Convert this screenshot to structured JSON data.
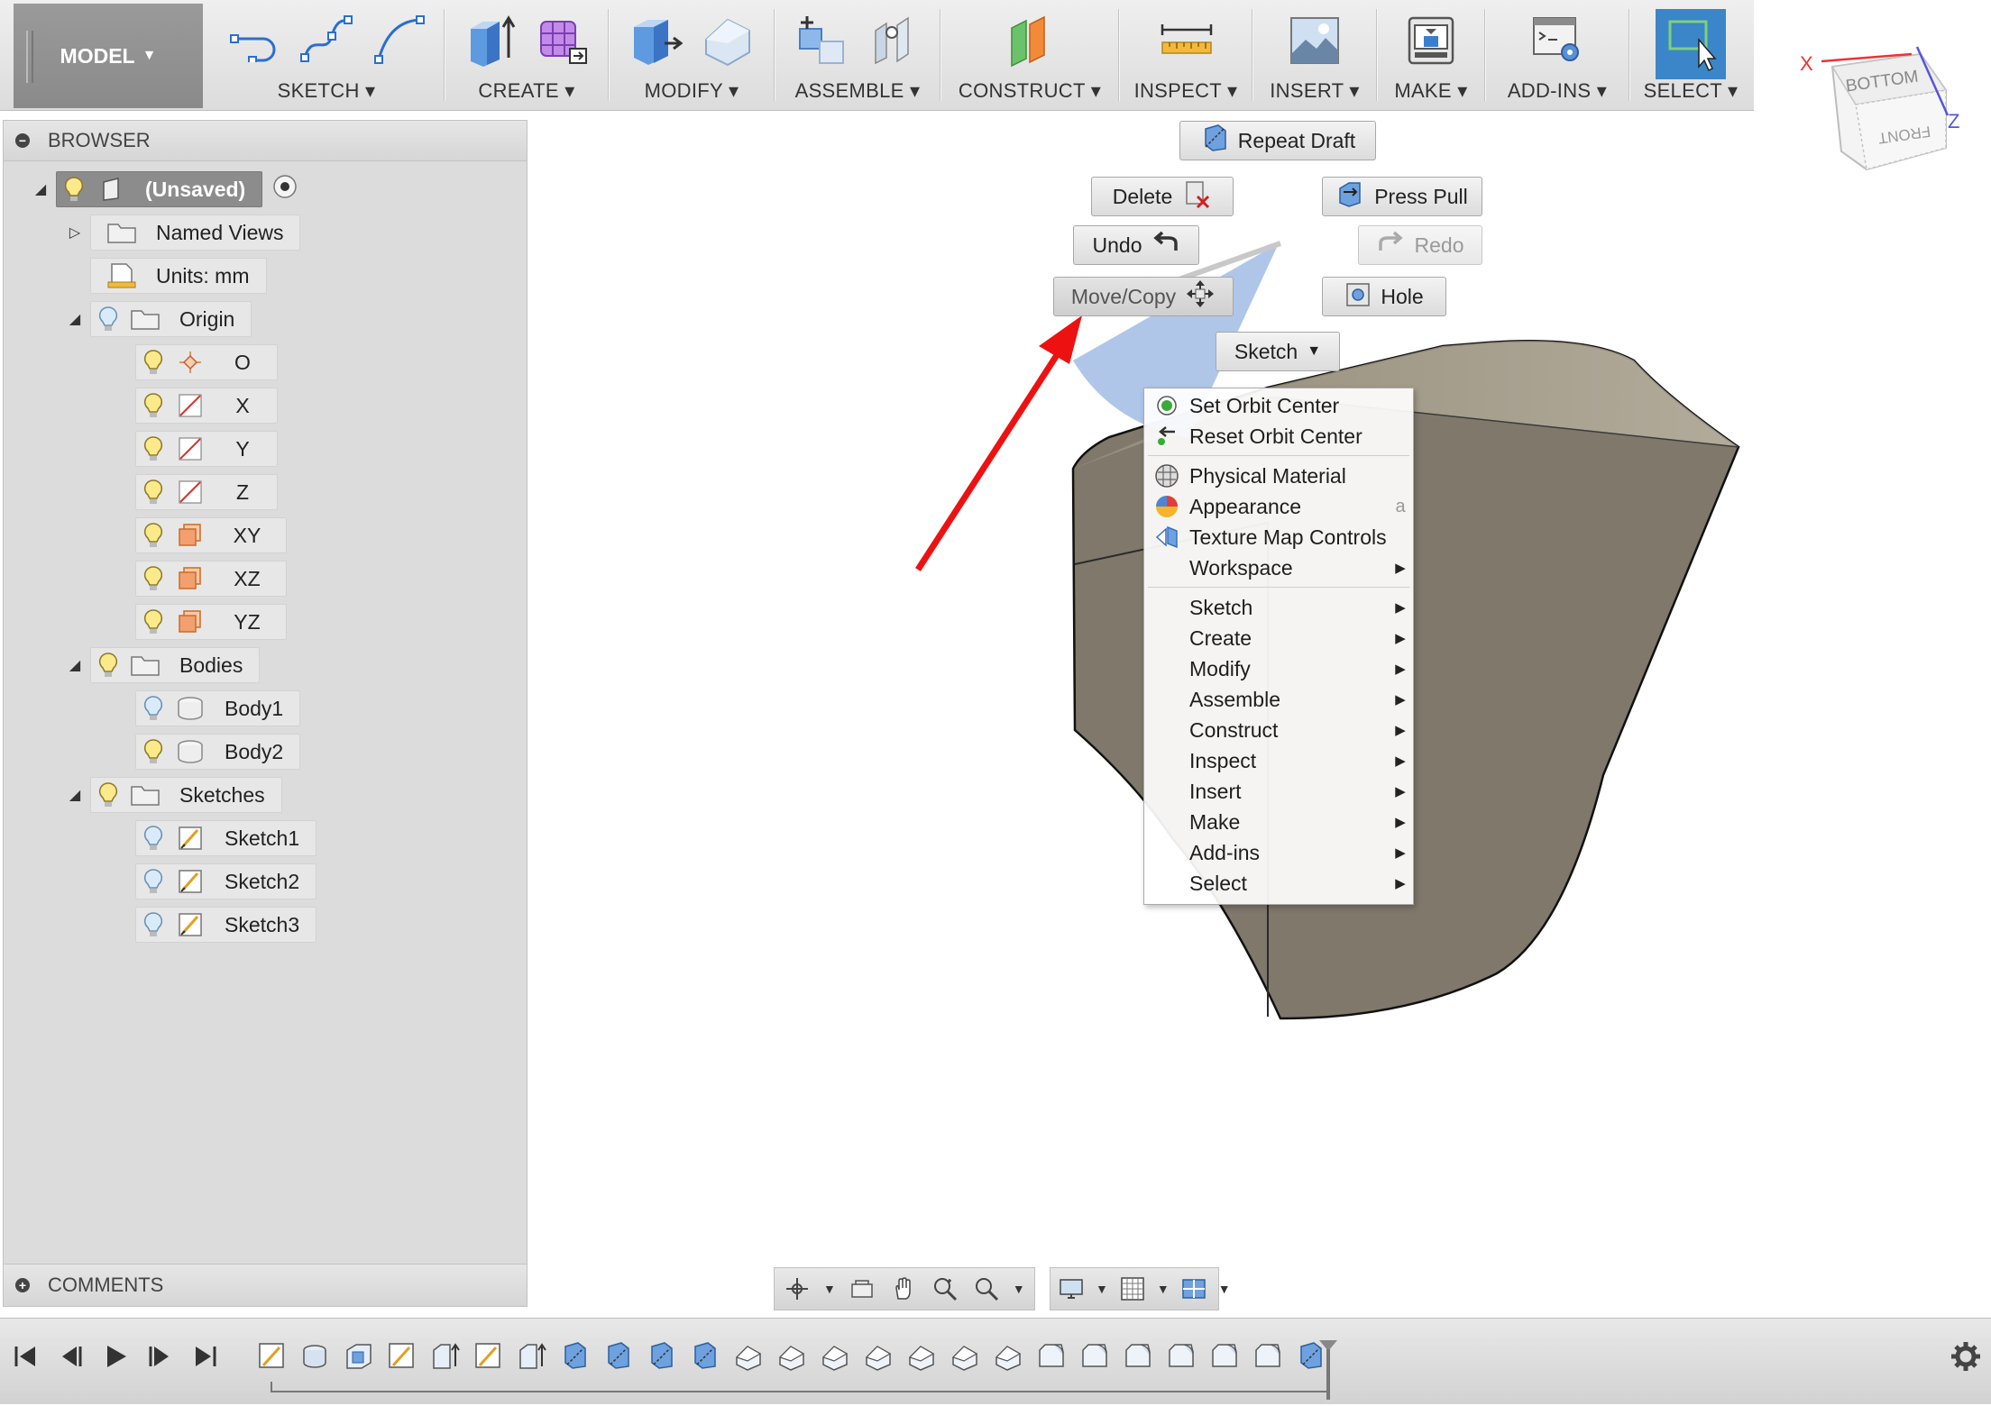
{
  "toolbar": {
    "model_label": "MODEL",
    "groups": [
      {
        "label": "SKETCH"
      },
      {
        "label": "CREATE"
      },
      {
        "label": "MODIFY"
      },
      {
        "label": "ASSEMBLE"
      },
      {
        "label": "CONSTRUCT"
      },
      {
        "label": "INSPECT"
      },
      {
        "label": "INSERT"
      },
      {
        "label": "MAKE"
      },
      {
        "label": "ADD-INS"
      },
      {
        "label": "SELECT"
      }
    ]
  },
  "viewcube": {
    "top_face": "BOTTOM",
    "front_face": "FRONT",
    "axis_x": "X",
    "axis_z": "Z"
  },
  "browser": {
    "title": "BROWSER",
    "root": "(Unsaved)",
    "named_views": "Named Views",
    "units": "Units: mm",
    "origin": "Origin",
    "origin_items": [
      "O",
      "X",
      "Y",
      "Z",
      "XY",
      "XZ",
      "YZ"
    ],
    "bodies": "Bodies",
    "body_items": [
      "Body1",
      "Body2"
    ],
    "sketches": "Sketches",
    "sketch_items": [
      "Sketch1",
      "Sketch2",
      "Sketch3"
    ]
  },
  "comments": {
    "title": "COMMENTS"
  },
  "marking_menu": {
    "repeat": "Repeat Draft",
    "delete": "Delete",
    "press_pull": "Press Pull",
    "undo": "Undo",
    "redo": "Redo",
    "move_copy": "Move/Copy",
    "hole": "Hole",
    "sketch": "Sketch"
  },
  "context_menu": {
    "items": [
      {
        "label": "Set Orbit Center"
      },
      {
        "label": "Reset Orbit Center"
      },
      {
        "label": "Physical Material"
      },
      {
        "label": "Appearance",
        "shortcut": "a"
      },
      {
        "label": "Texture Map Controls"
      },
      {
        "label": "Workspace"
      },
      {
        "label": "Sketch"
      },
      {
        "label": "Create"
      },
      {
        "label": "Modify"
      },
      {
        "label": "Assemble"
      },
      {
        "label": "Construct"
      },
      {
        "label": "Inspect"
      },
      {
        "label": "Insert"
      },
      {
        "label": "Make"
      },
      {
        "label": "Add-ins"
      },
      {
        "label": "Select"
      }
    ]
  },
  "colors": {
    "select_blue": "#3a86c8",
    "annotation_arrow": "#ee1111",
    "body_fill": "#7f786b",
    "gesture_wedge": "#8eaee0"
  }
}
